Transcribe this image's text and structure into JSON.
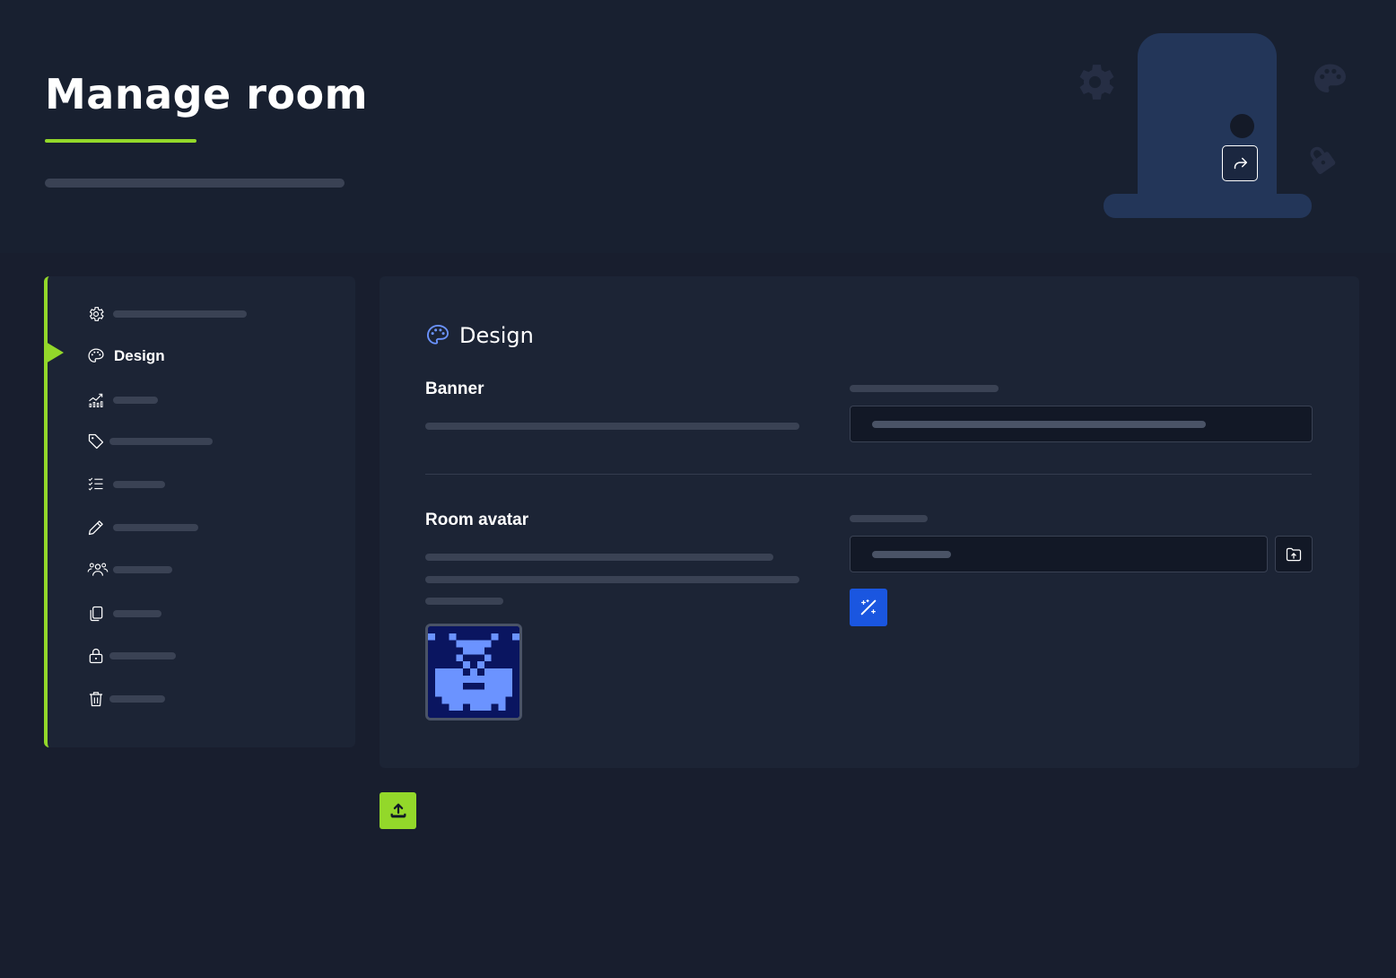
{
  "header": {
    "title": "Manage room"
  },
  "sidebar": {
    "items": [
      {
        "icon": "gear-icon",
        "label": ""
      },
      {
        "icon": "palette-icon",
        "label": "Design",
        "active": true
      },
      {
        "icon": "chart-icon",
        "label": ""
      },
      {
        "icon": "tag-icon",
        "label": ""
      },
      {
        "icon": "checklist-icon",
        "label": ""
      },
      {
        "icon": "pencil-icon",
        "label": ""
      },
      {
        "icon": "users-icon",
        "label": ""
      },
      {
        "icon": "copy-icon",
        "label": ""
      },
      {
        "icon": "lock-icon",
        "label": ""
      },
      {
        "icon": "trash-icon",
        "label": ""
      }
    ]
  },
  "main": {
    "section_title": "Design",
    "section_icon": "palette-icon",
    "banner": {
      "label": "Banner"
    },
    "room_avatar": {
      "label": "Room avatar"
    }
  },
  "colors": {
    "accent": "#93d82a",
    "primary_button": "#1a56e0",
    "background": "#181e2e",
    "panel": "#1c2435"
  }
}
